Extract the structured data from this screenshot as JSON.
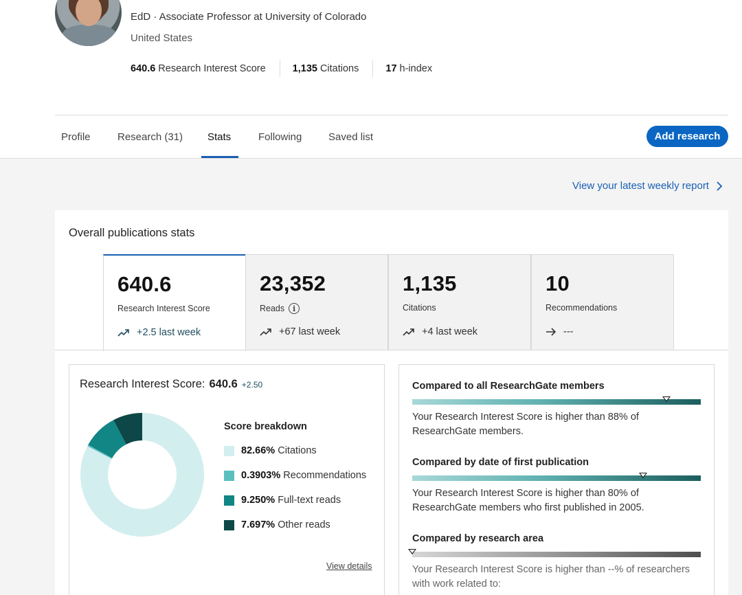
{
  "profile": {
    "subtitle": "EdD · Associate Professor at University of Colorado",
    "country": "United States",
    "metrics": [
      {
        "value": "640.6",
        "label": "Research Interest Score"
      },
      {
        "value": "1,135",
        "label": "Citations"
      },
      {
        "value": "17",
        "label": "h-index"
      }
    ]
  },
  "tabs": [
    {
      "label": "Profile"
    },
    {
      "label": "Research (31)"
    },
    {
      "label": "Stats",
      "active": true
    },
    {
      "label": "Following"
    },
    {
      "label": "Saved list"
    }
  ],
  "add_research_label": "Add research",
  "weekly_report_link": "View your latest weekly report",
  "stats": {
    "title": "Overall publications stats",
    "kpis": [
      {
        "value": "640.6",
        "label": "Research Interest Score",
        "trend_icon": "trending-up-icon",
        "trend": "+2.5 last week"
      },
      {
        "value": "23,352",
        "label": "Reads",
        "trend_icon": "trending-up-icon",
        "trend": "+67 last week"
      },
      {
        "value": "1,135",
        "label": "Citations",
        "trend_icon": "trending-up-icon",
        "trend": "+4 last week"
      },
      {
        "value": "10",
        "label": "Recommendations",
        "trend_icon": "arrow-right-icon",
        "trend": "---"
      }
    ]
  },
  "ris": {
    "title": "Research Interest Score:",
    "value": "640.6",
    "delta": "+2.50",
    "breakdown_title": "Score breakdown",
    "view_details": "View details"
  },
  "chart_data": {
    "type": "pie",
    "categories": [
      "Citations",
      "Recommendations",
      "Full-text reads",
      "Other reads"
    ],
    "values": [
      82.66,
      0.3903,
      9.25,
      7.697
    ],
    "labels": [
      "82.66%",
      "0.3903%",
      "9.250%",
      "7.697%"
    ],
    "colors": [
      "#d3eeee",
      "#5bbfbf",
      "#128585",
      "#0e4747"
    ],
    "title": "Score breakdown",
    "donut": true
  },
  "comparisons": [
    {
      "title": "Compared to all ResearchGate members",
      "marker_fraction": 0.88,
      "bar": "teal",
      "text": "Your Research Interest Score is higher than 88% of ResearchGate members."
    },
    {
      "title": "Compared by date of first publication",
      "marker_fraction": 0.8,
      "bar": "teal",
      "text": "Your Research Interest Score is higher than 80% of ResearchGate members who first published in 2005."
    },
    {
      "title": "Compared by research area",
      "marker_fraction": 0.0,
      "bar": "gray",
      "text": "Your Research Interest Score is higher than --% of researchers with work related to:"
    }
  ],
  "colors": {
    "accent": "#0a66c2",
    "link": "#1a5fb4",
    "teal_dark": "#1f4e5f"
  }
}
